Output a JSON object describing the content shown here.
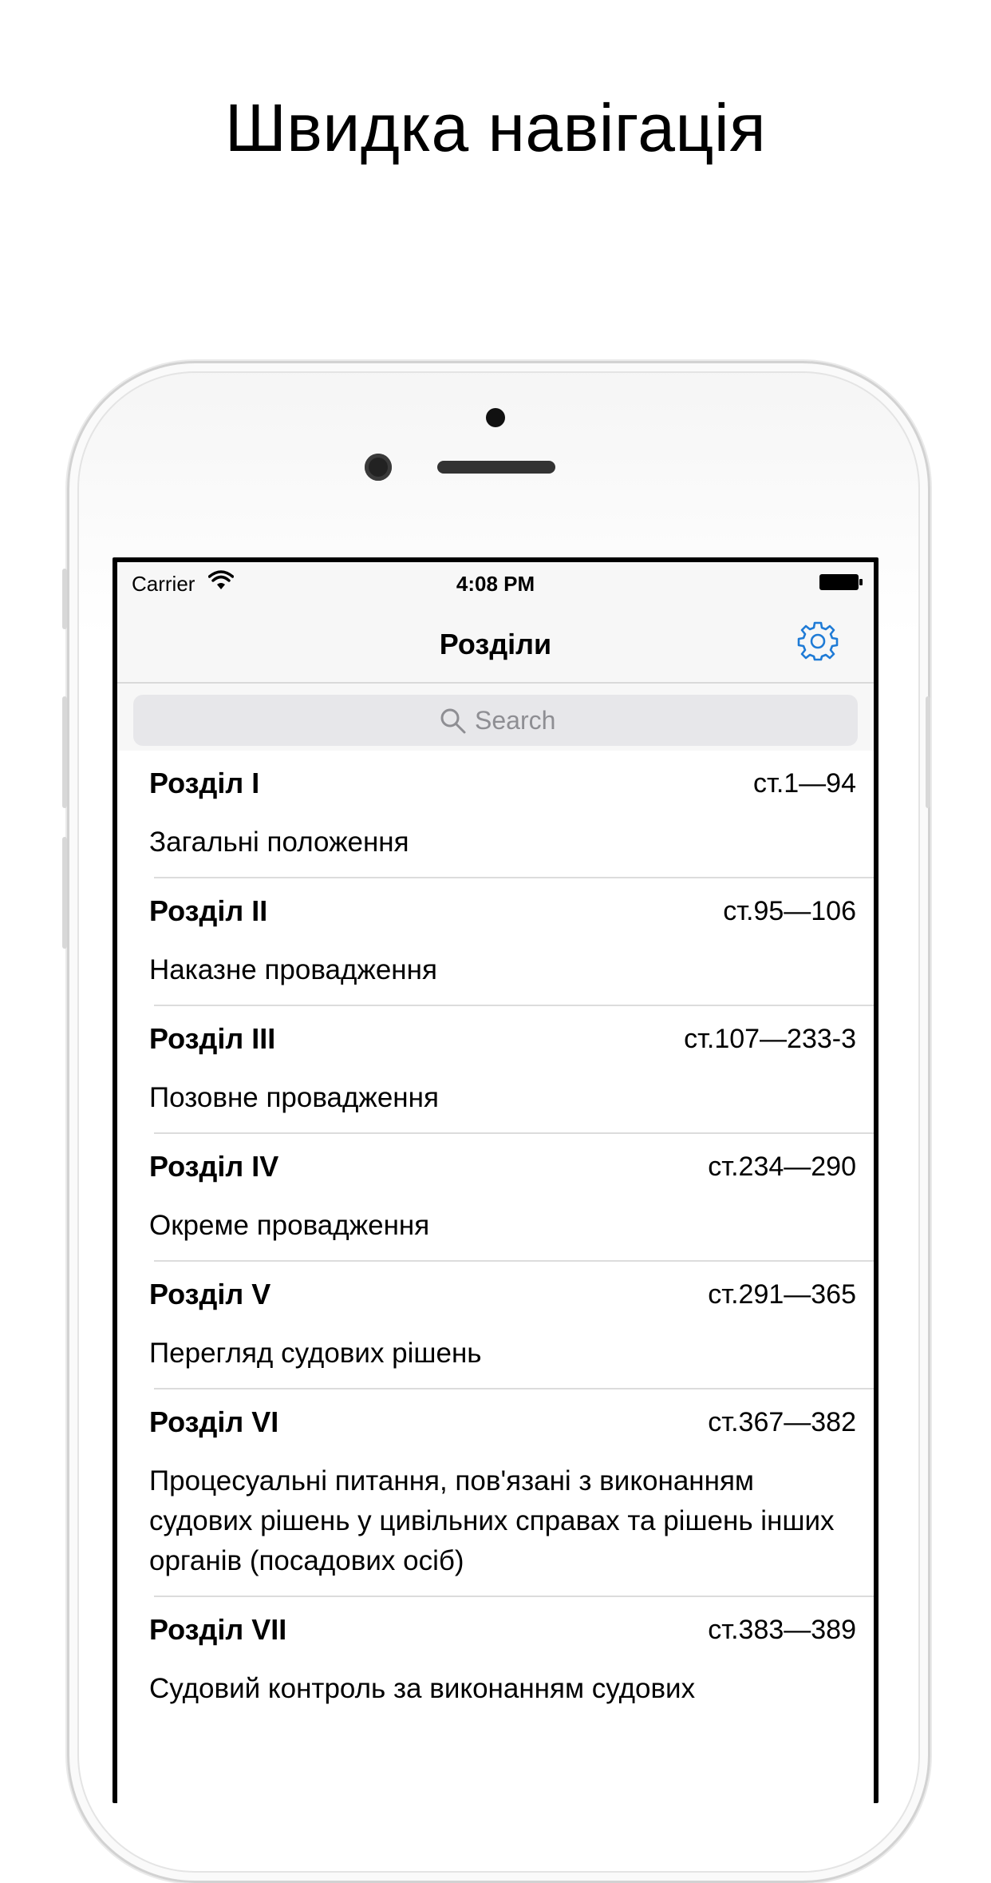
{
  "headline": "Швидка навігація",
  "status_bar": {
    "carrier": "Carrier",
    "time": "4:08 PM"
  },
  "nav": {
    "title": "Розділи"
  },
  "search": {
    "placeholder": "Search"
  },
  "colors": {
    "accent": "#1f7bd6",
    "bar_bg": "#f7f7f7",
    "separator": "#dcdcdc"
  },
  "icons": {
    "settings": "gear-icon",
    "search": "search-icon",
    "wifi": "wifi-icon",
    "battery": "battery-icon"
  },
  "sections": [
    {
      "title": "Розділ I",
      "range": "ст.1—94",
      "description": "Загальні положення"
    },
    {
      "title": "Розділ II",
      "range": "ст.95—106",
      "description": "Наказне провадження"
    },
    {
      "title": "Розділ III",
      "range": "ст.107—233-3",
      "description": "Позовне провадження"
    },
    {
      "title": "Розділ IV",
      "range": "ст.234—290",
      "description": "Окреме провадження"
    },
    {
      "title": "Розділ V",
      "range": "ст.291—365",
      "description": "Перегляд судових рішень"
    },
    {
      "title": "Розділ VI",
      "range": "ст.367—382",
      "description": "Процесуальні питання, пов'язані з виконанням судових рішень у цивільних справах та рішень інших органів (посадових осіб)"
    },
    {
      "title": "Розділ VII",
      "range": "ст.383—389",
      "description": "Судовий контроль за виконанням судових"
    }
  ]
}
